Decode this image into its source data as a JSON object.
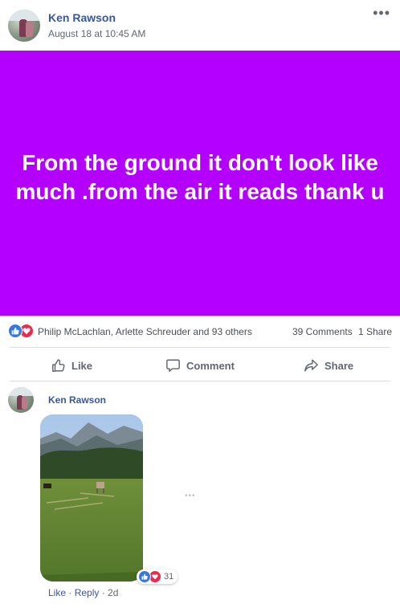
{
  "post": {
    "author": "Ken Rawson",
    "timestamp": "August 18 at 10:45 AM",
    "more_icon": "•••",
    "text": "From the ground it don't look like much .from the air it reads thank u",
    "background_color": "#b300ff"
  },
  "reactions": {
    "icons": [
      "like-icon",
      "love-icon"
    ],
    "summary": "Philip McLachlan, Arlette Schreuder and 93 others",
    "comments": "39 Comments",
    "shares": "1 Share"
  },
  "actions": {
    "like": "Like",
    "comment": "Comment",
    "share": "Share"
  },
  "comment": {
    "author": "Ken Rawson",
    "reaction_count": "31",
    "more_icon": "•••",
    "like_label": "Like",
    "separator": " · ",
    "reply_label": "Reply",
    "age": "2d"
  },
  "colors": {
    "link": "#385898",
    "like_blue": "#3578e5",
    "love_red": "#f0284a"
  }
}
